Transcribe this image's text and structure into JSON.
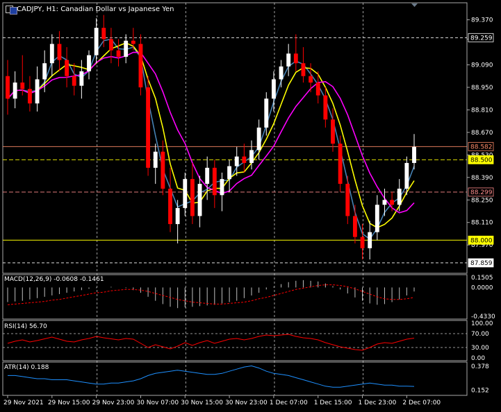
{
  "header": {
    "symbol": "CADJPY, H1:",
    "description": "Canadian Dollar vs Japanese Yen"
  },
  "colors": {
    "background": "#000000",
    "grid": "#c8c8c8",
    "bull": "#ffffff",
    "bear": "#ff0000",
    "ma_fast": "#4682b4",
    "ma_mid": "#ffff00",
    "ma_slow": "#ff00ff",
    "bid_line": "#ff8c69",
    "ask_line": "#ffff00",
    "level_line": "#ff8c8c",
    "macd_hist": "#c0c0c0",
    "macd_signal": "#ff0000",
    "rsi": "#ff0000",
    "atr": "#1e90ff"
  },
  "chart_data": [
    {
      "type": "candlestick",
      "pane": "price",
      "ylim": [
        87.82,
        89.45
      ],
      "y_ticks": [
        "89.370",
        "89.250",
        "89.090",
        "88.950",
        "88.810",
        "88.670",
        "88.530",
        "88.390",
        "88.250",
        "88.110",
        "87.970"
      ],
      "x_ticks": [
        "29 Nov 2021",
        "29 Nov 15:00",
        "29 Nov 23:00",
        "30 Nov 07:00",
        "30 Nov 15:00",
        "30 Nov 23:00",
        "1 Dec 07:00",
        "1 Dec 15:00",
        "1 Dec 23:00",
        "2 Dec 07:00"
      ],
      "price_labels": [
        "89.259",
        "88.582",
        "88.500",
        "88.299",
        "88.000",
        "87.859"
      ],
      "ohlc": [
        [
          89.02,
          89.12,
          88.78,
          88.88
        ],
        [
          88.88,
          89.05,
          88.82,
          88.98
        ],
        [
          88.98,
          89.15,
          88.9,
          88.94
        ],
        [
          88.94,
          89.02,
          88.8,
          88.85
        ],
        [
          88.85,
          89.08,
          88.8,
          89.0
        ],
        [
          89.0,
          89.18,
          88.92,
          89.1
        ],
        [
          89.1,
          89.28,
          89.02,
          89.22
        ],
        [
          89.22,
          89.3,
          89.05,
          89.12
        ],
        [
          89.12,
          89.2,
          88.95,
          89.02
        ],
        [
          89.02,
          89.1,
          88.9,
          88.96
        ],
        [
          88.96,
          89.12,
          88.88,
          89.05
        ],
        [
          89.05,
          89.18,
          89.0,
          89.15
        ],
        [
          89.15,
          89.38,
          89.1,
          89.32
        ],
        [
          89.32,
          89.4,
          89.2,
          89.25
        ],
        [
          89.25,
          89.32,
          89.1,
          89.18
        ],
        [
          89.18,
          89.25,
          89.08,
          89.14
        ],
        [
          89.14,
          89.28,
          89.1,
          89.24
        ],
        [
          89.24,
          89.32,
          89.18,
          89.22
        ],
        [
          89.22,
          89.28,
          88.9,
          88.95
        ],
        [
          88.95,
          89.02,
          88.4,
          88.45
        ],
        [
          88.45,
          88.6,
          88.35,
          88.55
        ],
        [
          88.55,
          88.62,
          88.28,
          88.32
        ],
        [
          88.32,
          88.45,
          88.05,
          88.1
        ],
        [
          88.1,
          88.25,
          87.98,
          88.2
        ],
        [
          88.2,
          88.42,
          88.15,
          88.38
        ],
        [
          88.38,
          88.48,
          88.1,
          88.15
        ],
        [
          88.15,
          88.4,
          88.08,
          88.35
        ],
        [
          88.35,
          88.52,
          88.25,
          88.45
        ],
        [
          88.45,
          88.5,
          88.2,
          88.28
        ],
        [
          88.28,
          88.42,
          88.18,
          88.38
        ],
        [
          88.38,
          88.5,
          88.3,
          88.46
        ],
        [
          88.46,
          88.58,
          88.4,
          88.52
        ],
        [
          88.52,
          88.6,
          88.42,
          88.48
        ],
        [
          88.48,
          88.62,
          88.44,
          88.56
        ],
        [
          88.56,
          88.75,
          88.5,
          88.7
        ],
        [
          88.7,
          88.92,
          88.65,
          88.88
        ],
        [
          88.88,
          89.05,
          88.8,
          89.0
        ],
        [
          89.0,
          89.12,
          88.95,
          89.08
        ],
        [
          89.08,
          89.22,
          89.02,
          89.16
        ],
        [
          89.16,
          89.28,
          89.05,
          89.1
        ],
        [
          89.1,
          89.2,
          88.98,
          89.02
        ],
        [
          89.02,
          89.1,
          88.92,
          88.98
        ],
        [
          88.98,
          89.05,
          88.85,
          88.9
        ],
        [
          88.9,
          88.95,
          88.7,
          88.75
        ],
        [
          88.75,
          88.82,
          88.55,
          88.6
        ],
        [
          88.6,
          88.65,
          88.3,
          88.35
        ],
        [
          88.35,
          88.4,
          88.1,
          88.15
        ],
        [
          88.15,
          88.22,
          87.98,
          88.02
        ],
        [
          88.02,
          88.1,
          87.88,
          87.95
        ],
        [
          87.95,
          88.12,
          87.88,
          88.05
        ],
        [
          88.05,
          88.28,
          88.0,
          88.22
        ],
        [
          88.22,
          88.32,
          88.15,
          88.25
        ],
        [
          88.25,
          88.3,
          88.18,
          88.22
        ],
        [
          88.22,
          88.38,
          88.18,
          88.32
        ],
        [
          88.32,
          88.52,
          88.28,
          88.48
        ],
        [
          88.48,
          88.66,
          88.44,
          88.58
        ]
      ],
      "indicators": [
        "MA fast",
        "MA mid",
        "MA slow"
      ]
    },
    {
      "type": "histogram",
      "pane": "macd",
      "label": "MACD(12,26,9) -0.0608 -0.1461",
      "ylim": [
        -0.433,
        0.1505
      ],
      "y_ticks": [
        "0.1505",
        "0.0000",
        "-0.4330"
      ],
      "series": [
        {
          "name": "MACD",
          "values": [
            -0.22,
            -0.21,
            -0.2,
            -0.18,
            -0.16,
            -0.14,
            -0.12,
            -0.1,
            -0.08,
            -0.06,
            -0.04,
            -0.02,
            -0.01,
            0.0,
            0.01,
            0.0,
            -0.01,
            -0.04,
            -0.08,
            -0.14,
            -0.2,
            -0.25,
            -0.29,
            -0.31,
            -0.3,
            -0.29,
            -0.28,
            -0.27,
            -0.26,
            -0.24,
            -0.22,
            -0.2,
            -0.16,
            -0.12,
            -0.08,
            -0.03,
            0.01,
            0.05,
            0.08,
            0.1,
            0.11,
            0.1,
            0.09,
            0.06,
            0.02,
            -0.03,
            -0.09,
            -0.15,
            -0.2,
            -0.24,
            -0.26,
            -0.25,
            -0.22,
            -0.18,
            -0.12,
            -0.06
          ]
        },
        {
          "name": "Signal",
          "values": [
            -0.26,
            -0.25,
            -0.24,
            -0.23,
            -0.22,
            -0.21,
            -0.19,
            -0.18,
            -0.16,
            -0.14,
            -0.12,
            -0.1,
            -0.08,
            -0.07,
            -0.05,
            -0.04,
            -0.03,
            -0.03,
            -0.04,
            -0.06,
            -0.09,
            -0.12,
            -0.15,
            -0.18,
            -0.2,
            -0.22,
            -0.23,
            -0.24,
            -0.25,
            -0.25,
            -0.24,
            -0.23,
            -0.22,
            -0.2,
            -0.17,
            -0.15,
            -0.12,
            -0.09,
            -0.06,
            -0.03,
            -0.01,
            0.01,
            0.03,
            0.04,
            0.04,
            0.03,
            0.01,
            -0.02,
            -0.06,
            -0.1,
            -0.14,
            -0.17,
            -0.18,
            -0.18,
            -0.17,
            -0.15
          ]
        }
      ]
    },
    {
      "type": "line",
      "pane": "rsi",
      "label": "RSI(14) 56.70",
      "ylim": [
        0,
        100
      ],
      "y_ticks": [
        "100.00",
        "70.00",
        "30.00",
        "0.00"
      ],
      "values": [
        42,
        48,
        52,
        46,
        50,
        55,
        60,
        54,
        48,
        46,
        52,
        56,
        62,
        58,
        55,
        52,
        56,
        54,
        42,
        30,
        38,
        32,
        26,
        34,
        44,
        36,
        44,
        50,
        42,
        48,
        54,
        56,
        52,
        56,
        62,
        66,
        64,
        66,
        68,
        62,
        58,
        56,
        52,
        44,
        38,
        32,
        28,
        24,
        22,
        30,
        40,
        44,
        42,
        48,
        54,
        57
      ]
    },
    {
      "type": "line",
      "pane": "atr",
      "label": "ATR(14) 0.188",
      "ylim": [
        0.13,
        0.39
      ],
      "y_ticks": [
        "0.378",
        "0.152"
      ],
      "values": [
        0.29,
        0.29,
        0.28,
        0.27,
        0.26,
        0.26,
        0.25,
        0.25,
        0.25,
        0.24,
        0.23,
        0.22,
        0.21,
        0.21,
        0.22,
        0.22,
        0.23,
        0.24,
        0.26,
        0.29,
        0.31,
        0.32,
        0.33,
        0.34,
        0.33,
        0.32,
        0.31,
        0.3,
        0.3,
        0.31,
        0.33,
        0.35,
        0.37,
        0.38,
        0.36,
        0.33,
        0.31,
        0.3,
        0.29,
        0.27,
        0.25,
        0.23,
        0.21,
        0.19,
        0.18,
        0.18,
        0.19,
        0.2,
        0.21,
        0.22,
        0.21,
        0.2,
        0.2,
        0.19,
        0.19,
        0.188
      ]
    }
  ]
}
